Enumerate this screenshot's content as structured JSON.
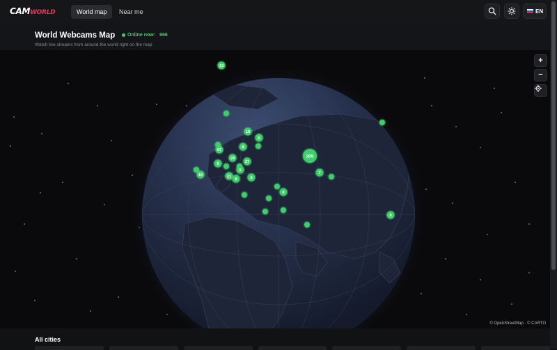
{
  "topbar": {
    "logo": {
      "part1": "CAM",
      "part2": "WORLD"
    },
    "tabs": [
      {
        "label": "World map",
        "active": true
      },
      {
        "label": "Near me",
        "active": false
      }
    ],
    "icons": [
      "search-icon",
      "sun-icon"
    ],
    "language": {
      "code": "EN",
      "flag_colors": [
        "#ffffff",
        "#2f5bd6",
        "#d8282e"
      ]
    }
  },
  "header": {
    "title": "World Webcams Map",
    "online_label": "Online now:",
    "online_count": "666",
    "subtitle": "Watch live streams from around the world right on the map"
  },
  "map": {
    "zoom_in": "+",
    "zoom_out": "−",
    "locate_icon": "crosshair-icon",
    "attribution": "© OpenStreetMap · © CARTO",
    "marker_color": "#3fcf6a",
    "clusters": [
      {
        "label": "13"
      },
      {
        "label": ""
      },
      {
        "label": ""
      },
      {
        "label": "19"
      },
      {
        "label": "6"
      },
      {
        "label": ""
      },
      {
        "label": "67"
      },
      {
        "label": "8"
      },
      {
        "label": ""
      },
      {
        "label": "209"
      },
      {
        "label": "24"
      },
      {
        "label": "9"
      },
      {
        "label": "27"
      },
      {
        "label": ""
      },
      {
        "label": ""
      },
      {
        "label": "16"
      },
      {
        "label": "5"
      },
      {
        "label": "7"
      },
      {
        "label": "21"
      },
      {
        "label": "8"
      },
      {
        "label": "9"
      },
      {
        "label": ""
      },
      {
        "label": ""
      },
      {
        "label": ""
      },
      {
        "label": "8"
      },
      {
        "label": ""
      },
      {
        "label": ""
      },
      {
        "label": ""
      },
      {
        "label": ""
      },
      {
        "label": "8"
      },
      {
        "label": ""
      }
    ]
  },
  "sections": {
    "all_cities": "All cities"
  }
}
